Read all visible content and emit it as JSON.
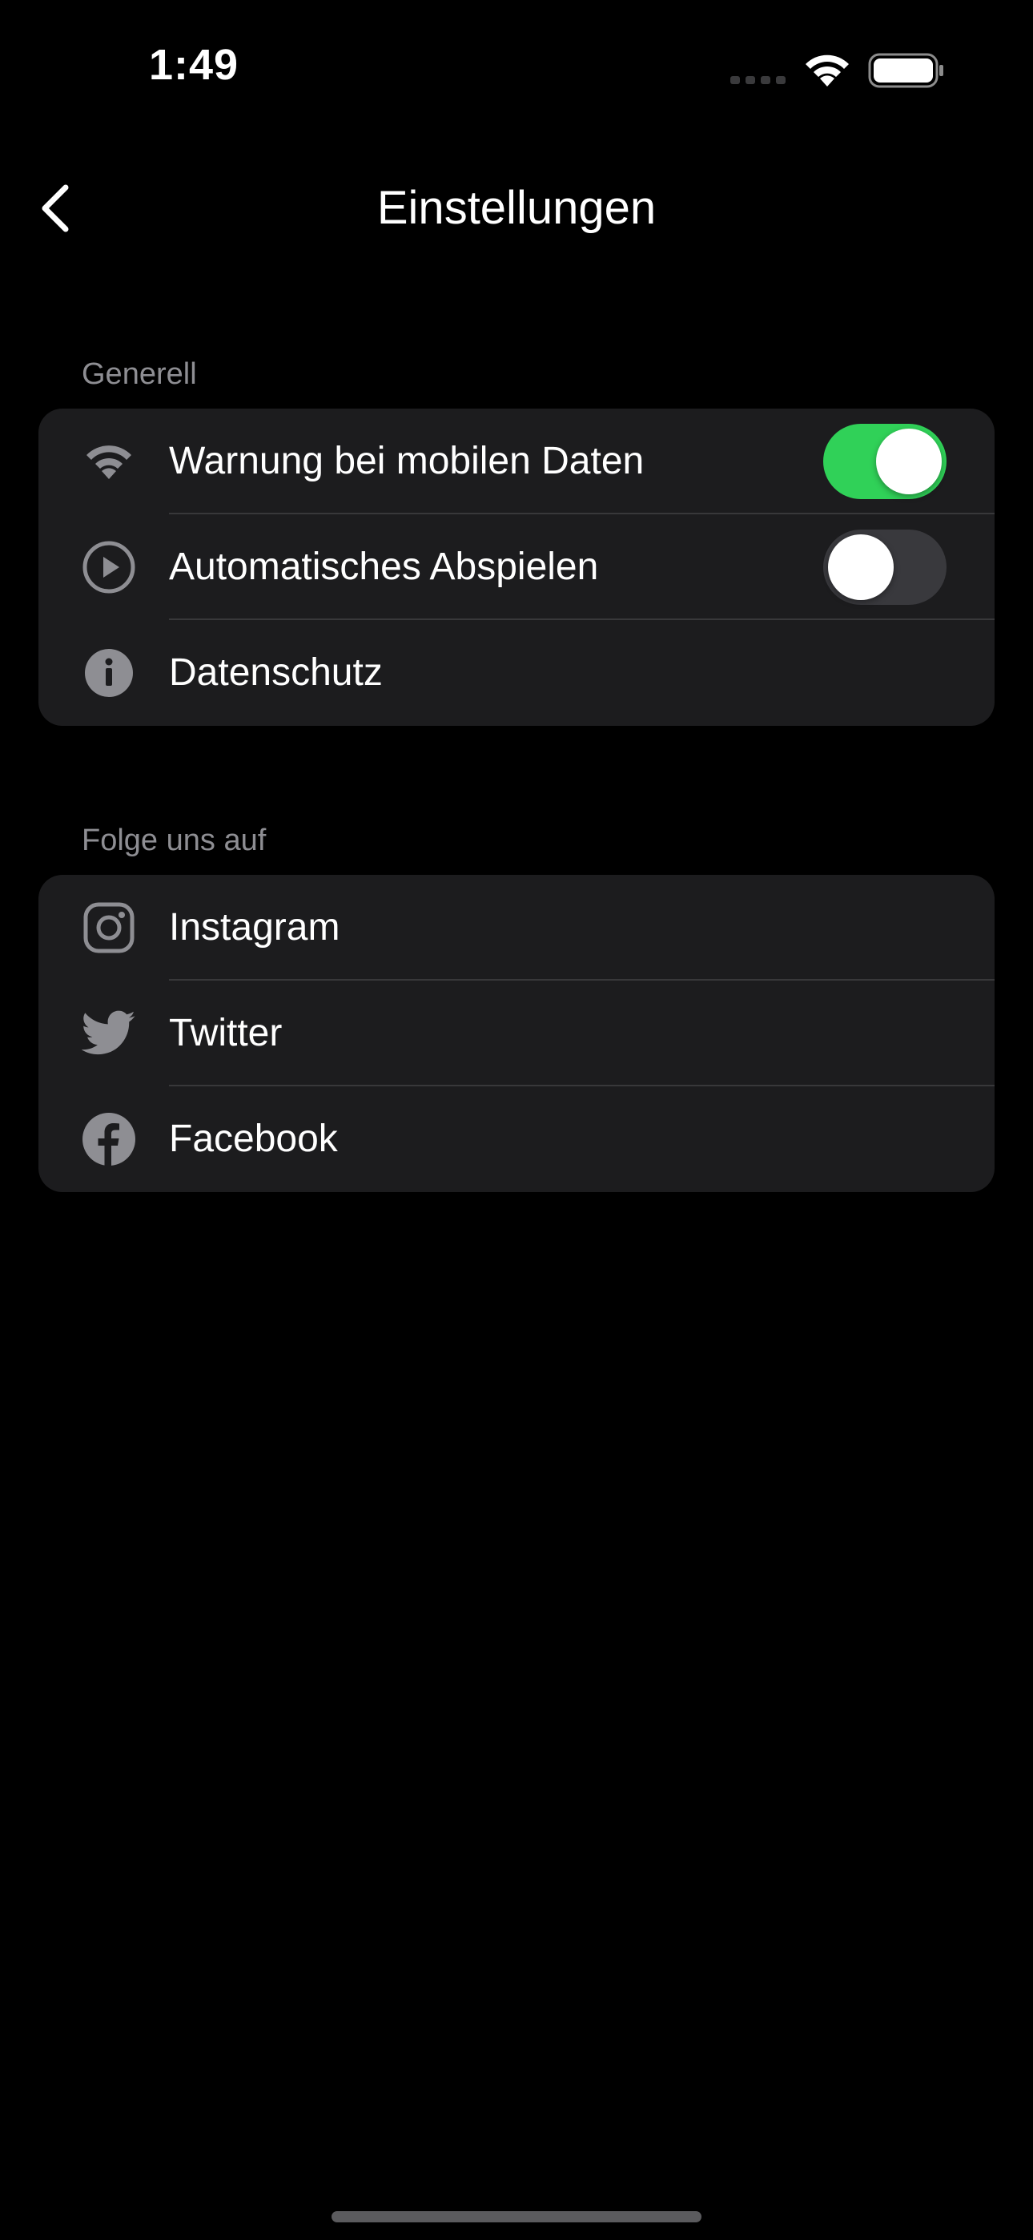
{
  "status_bar": {
    "time": "1:49",
    "icons": [
      "signal-dots-icon",
      "wifi-icon",
      "battery-icon"
    ]
  },
  "nav": {
    "title": "Einstellungen",
    "back_icon": "chevron-left-icon"
  },
  "sections": {
    "general": {
      "header": "Generell",
      "items": [
        {
          "label": "Warnung bei mobilen Daten",
          "icon": "wifi-icon",
          "toggle": true
        },
        {
          "label": "Automatisches Abspielen",
          "icon": "play-circle-icon",
          "toggle": false
        },
        {
          "label": "Datenschutz",
          "icon": "info-icon"
        }
      ]
    },
    "social": {
      "header": "Folge uns auf",
      "items": [
        {
          "label": "Instagram",
          "icon": "instagram-icon"
        },
        {
          "label": "Twitter",
          "icon": "twitter-icon"
        },
        {
          "label": "Facebook",
          "icon": "facebook-icon"
        }
      ]
    }
  },
  "colors": {
    "background": "#000000",
    "card": "#1c1c1e",
    "divider": "#38383a",
    "secondary_text": "#8e8e93",
    "icon_gray": "#8e8e93",
    "toggle_on": "#30d158",
    "toggle_off": "#39393d"
  }
}
